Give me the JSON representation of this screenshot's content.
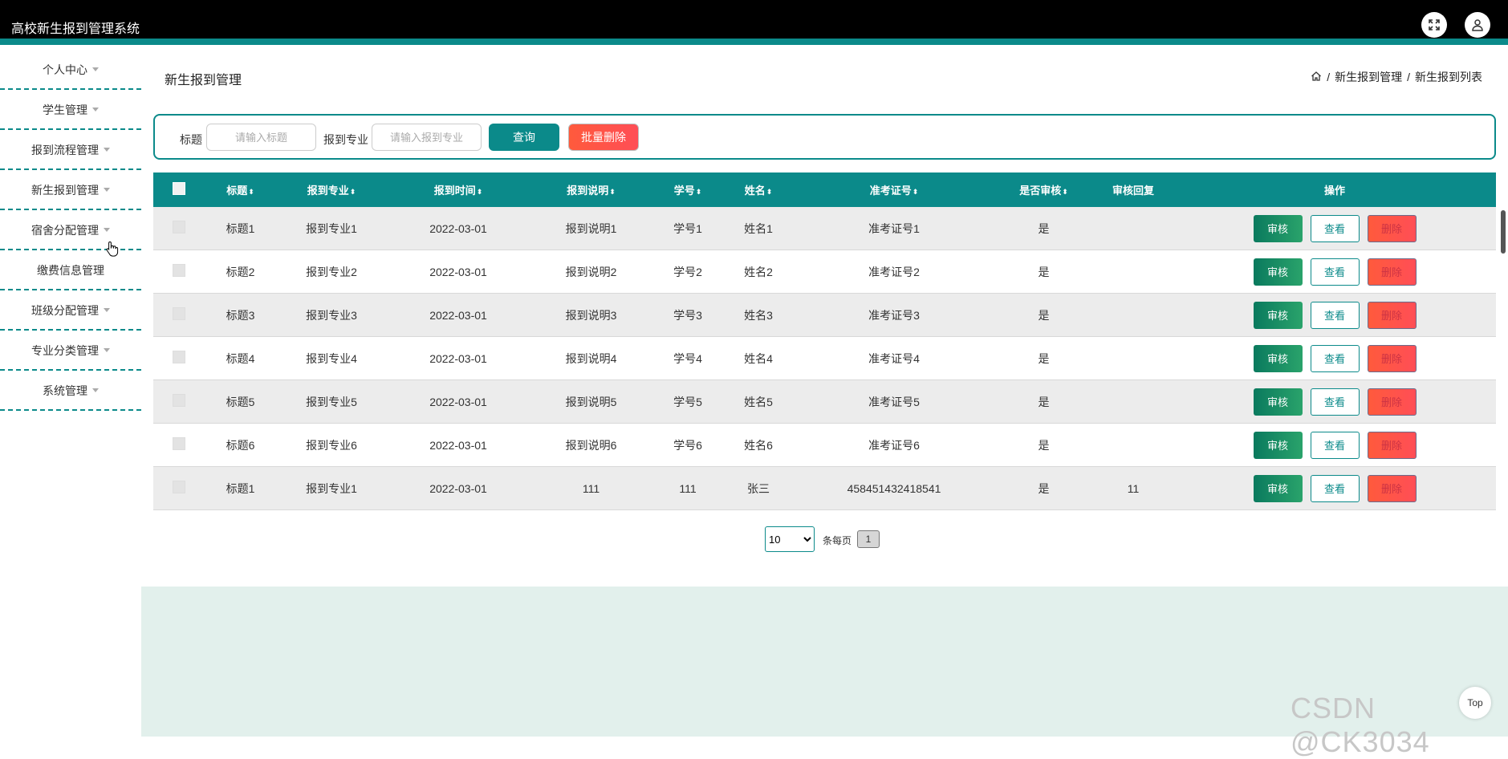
{
  "header": {
    "title": "高校新生报到管理系统",
    "fullscreen_icon": "expand-icon",
    "user_icon": "user-icon"
  },
  "sidebar": {
    "items": [
      {
        "label": "个人中心",
        "has_caret": true
      },
      {
        "label": "学生管理",
        "has_caret": true
      },
      {
        "label": "报到流程管理",
        "has_caret": true
      },
      {
        "label": "新生报到管理",
        "has_caret": true
      },
      {
        "label": "宿舍分配管理",
        "has_caret": true
      },
      {
        "label": "缴费信息管理",
        "has_caret": false
      },
      {
        "label": "班级分配管理",
        "has_caret": true
      },
      {
        "label": "专业分类管理",
        "has_caret": true
      },
      {
        "label": "系统管理",
        "has_caret": true
      }
    ]
  },
  "page": {
    "title": "新生报到管理",
    "breadcrumb": {
      "sep": "/",
      "level1": "新生报到管理",
      "level2": "新生报到列表"
    }
  },
  "search": {
    "title_label": "标题",
    "title_placeholder": "请输入标题",
    "major_label": "报到专业",
    "major_placeholder": "请输入报到专业",
    "query_button": "查询",
    "batch_delete_button": "批量删除"
  },
  "table": {
    "columns": [
      "标题",
      "报到专业",
      "报到时间",
      "报到说明",
      "学号",
      "姓名",
      "准考证号",
      "是否审核",
      "审核回复",
      "操作"
    ],
    "sort_icon": "⬍",
    "rows": [
      [
        "标题1",
        "报到专业1",
        "2022-03-01",
        "报到说明1",
        "学号1",
        "姓名1",
        "准考证号1",
        "是",
        ""
      ],
      [
        "标题2",
        "报到专业2",
        "2022-03-01",
        "报到说明2",
        "学号2",
        "姓名2",
        "准考证号2",
        "是",
        ""
      ],
      [
        "标题3",
        "报到专业3",
        "2022-03-01",
        "报到说明3",
        "学号3",
        "姓名3",
        "准考证号3",
        "是",
        ""
      ],
      [
        "标题4",
        "报到专业4",
        "2022-03-01",
        "报到说明4",
        "学号4",
        "姓名4",
        "准考证号4",
        "是",
        ""
      ],
      [
        "标题5",
        "报到专业5",
        "2022-03-01",
        "报到说明5",
        "学号5",
        "姓名5",
        "准考证号5",
        "是",
        ""
      ],
      [
        "标题6",
        "报到专业6",
        "2022-03-01",
        "报到说明6",
        "学号6",
        "姓名6",
        "准考证号6",
        "是",
        ""
      ],
      [
        "标题1",
        "报到专业1",
        "2022-03-01",
        "111",
        "111",
        "张三",
        "458451432418541",
        "是",
        "11"
      ]
    ],
    "actions": {
      "review": "审核",
      "view": "查看",
      "delete": "删除"
    }
  },
  "pagination": {
    "page_size": "10",
    "page_size_options": [
      "10"
    ],
    "per_page_label": "条每页",
    "current_page": "1"
  },
  "watermark": "CSDN @CK3034",
  "back_to_top": "Top",
  "colors": {
    "teal": "#0b8a8a",
    "header_bg": "#000000",
    "danger": "#ff5a3c",
    "success": "#1e8f66"
  }
}
